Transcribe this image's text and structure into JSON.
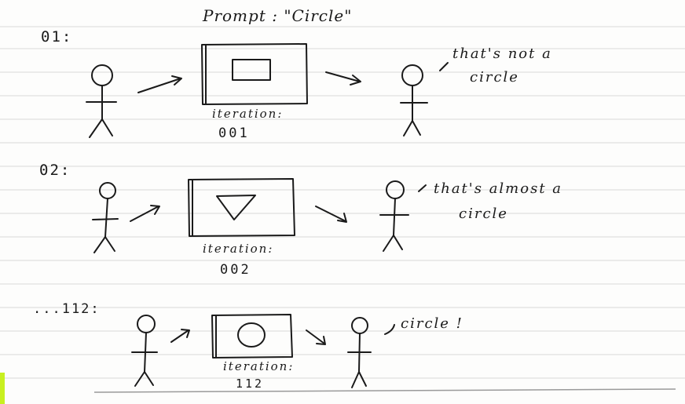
{
  "title": "Prompt : \"Circle\"",
  "rows": [
    {
      "label": "01:",
      "comment_lines": [
        "that's  not   a",
        "circle"
      ],
      "iteration_label": "iteration:",
      "iteration_number": "001",
      "shape": "rectangle"
    },
    {
      "label": "02:",
      "comment_lines": [
        "that's almost   a",
        "circle"
      ],
      "iteration_label": "iteration:",
      "iteration_number": "002",
      "shape": "triangle"
    },
    {
      "label": "...112:",
      "comment_lines": [
        "circle !"
      ],
      "iteration_label": "iteration:",
      "iteration_number": "112",
      "shape": "circle"
    }
  ]
}
